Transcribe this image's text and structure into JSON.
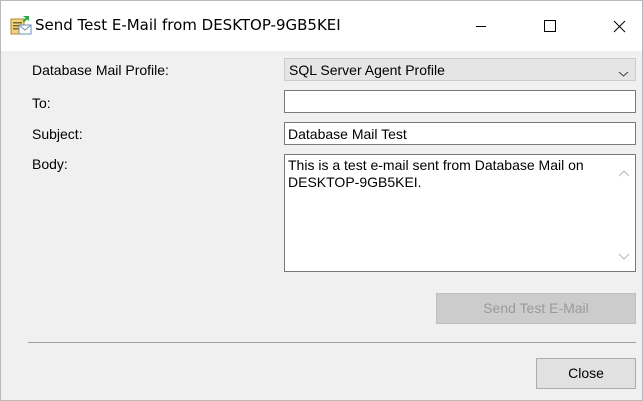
{
  "window": {
    "title": "Send Test E-Mail from DESKTOP-9GB5KEI"
  },
  "form": {
    "profile_label": "Database Mail Profile:",
    "profile_value": "SQL Server Agent Profile",
    "to_label": "To:",
    "to_value": "",
    "subject_label": "Subject:",
    "subject_value": "Database Mail Test",
    "body_label": "Body:",
    "body_value": "This is a test e-mail sent from Database Mail on DESKTOP-9GB5KEI."
  },
  "buttons": {
    "send_label": "Send Test E-Mail",
    "close_label": "Close"
  },
  "icons": {
    "app": "send-mail-app-icon",
    "minimize": "minimize-icon",
    "maximize": "maximize-icon",
    "close": "close-icon",
    "dropdown": "chevron-down-icon",
    "scroll_up": "chevron-up-icon",
    "scroll_down": "chevron-down-icon"
  },
  "colors": {
    "window_bg": "#f0f0f0",
    "titlebar_bg": "#ffffff",
    "disabled_button": "#cccccc",
    "disabled_text": "#9a9a9a",
    "button_bg": "#e1e1e1"
  }
}
